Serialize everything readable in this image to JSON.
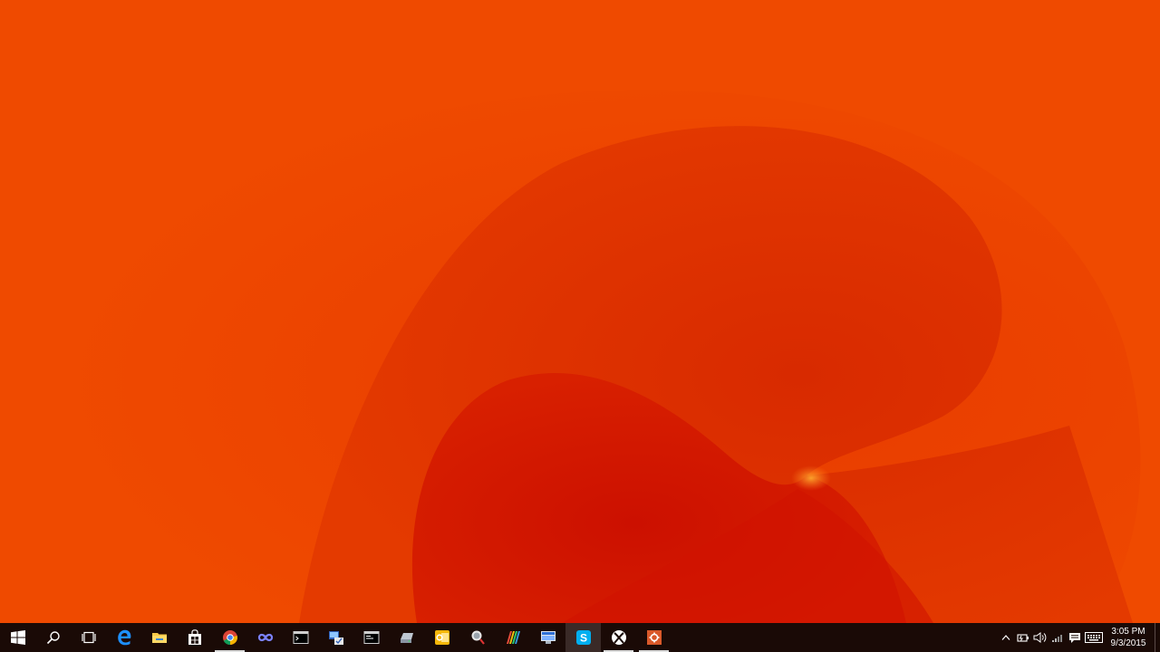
{
  "wallpaper": {
    "colors": {
      "base": "#ef4a00",
      "shade": "#d93200",
      "deep": "#d31400",
      "glow": "#ff7a1a"
    }
  },
  "taskbar": {
    "background": "#1a0a06",
    "buttons": [
      {
        "name": "start-button",
        "icon": "windows-logo-icon"
      },
      {
        "name": "search-button",
        "icon": "search-icon"
      },
      {
        "name": "task-view-button",
        "icon": "task-view-icon"
      },
      {
        "name": "edge-button",
        "icon": "edge-icon"
      },
      {
        "name": "file-explorer-button",
        "icon": "folder-icon"
      },
      {
        "name": "store-button",
        "icon": "store-icon"
      },
      {
        "name": "chrome-button",
        "icon": "chrome-icon",
        "running": true
      },
      {
        "name": "infinity-app-button",
        "icon": "infinity-icon"
      },
      {
        "name": "terminal-button",
        "icon": "terminal-icon"
      },
      {
        "name": "network-tool-button",
        "icon": "network-icon"
      },
      {
        "name": "console-button",
        "icon": "console-icon"
      },
      {
        "name": "drive-app-button",
        "icon": "drive-icon"
      },
      {
        "name": "outlook-button",
        "icon": "outlook-icon"
      },
      {
        "name": "magnifier-app-button",
        "icon": "magnifier-icon"
      },
      {
        "name": "paint-app-button",
        "icon": "paint-icon"
      },
      {
        "name": "remote-desktop-button",
        "icon": "remote-desktop-icon"
      },
      {
        "name": "skype-button",
        "icon": "skype-icon",
        "active": true
      },
      {
        "name": "xbox-button",
        "icon": "xbox-icon",
        "running": true
      },
      {
        "name": "settings-app-button",
        "icon": "gear-icon",
        "running": true
      }
    ]
  },
  "tray": {
    "icons": [
      "chevron-up-icon",
      "power-icon",
      "volume-icon",
      "signal-icon",
      "notification-icon",
      "keyboard-icon"
    ],
    "time": "3:05 PM",
    "date": "9/3/2015"
  }
}
